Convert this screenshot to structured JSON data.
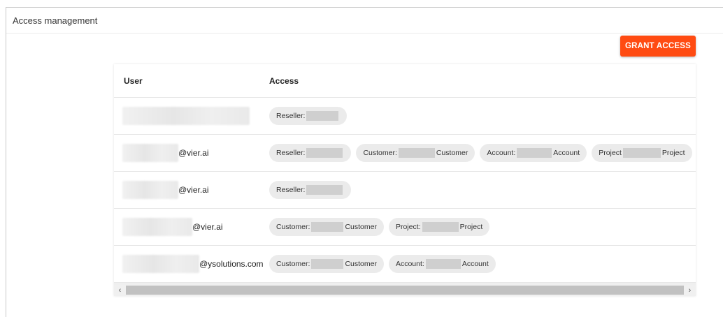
{
  "header": {
    "title": "Access management"
  },
  "toolbar": {
    "grant_label": "GRANT ACCESS"
  },
  "table": {
    "columns": {
      "user": "User",
      "access": "Access"
    },
    "rows": [
      {
        "user_suffix": "",
        "chips": [
          {
            "prefix": "Reseller:",
            "suffix": ""
          }
        ]
      },
      {
        "user_suffix": "@vier.ai",
        "chips": [
          {
            "prefix": "Reseller:",
            "suffix": ""
          },
          {
            "prefix": "Customer:",
            "suffix": "Customer"
          },
          {
            "prefix": "Account:",
            "suffix": "Account"
          },
          {
            "prefix": "Project",
            "suffix": "Project"
          }
        ]
      },
      {
        "user_suffix": "@vier.ai",
        "chips": [
          {
            "prefix": "Reseller:",
            "suffix": ""
          }
        ]
      },
      {
        "user_suffix": "@vier.ai",
        "chips": [
          {
            "prefix": "Customer:",
            "suffix": "Customer"
          },
          {
            "prefix": "Project:",
            "suffix": "Project"
          }
        ]
      },
      {
        "user_suffix": "@ysolutions.com",
        "chips": [
          {
            "prefix": "Customer:",
            "suffix": "Customer"
          },
          {
            "prefix": "Account:",
            "suffix": "Account"
          }
        ]
      }
    ]
  },
  "scrollbar": {
    "left_arrow": "‹",
    "right_arrow": "›"
  },
  "colors": {
    "accent": "#ff4b12"
  }
}
